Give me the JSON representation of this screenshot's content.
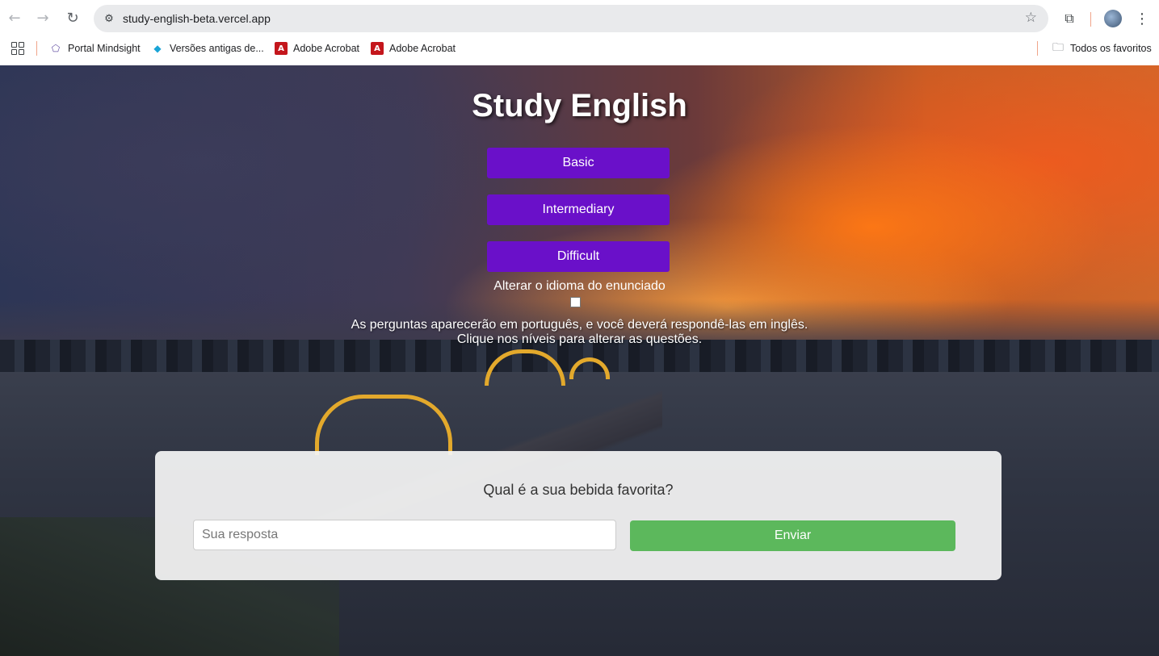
{
  "browser": {
    "url": "study-english-beta.vercel.app",
    "bookmarks": [
      {
        "label": "Portal Mindsight",
        "icon": "pentagon-icon"
      },
      {
        "label": "Versões antigas de...",
        "icon": "diamond-icon"
      },
      {
        "label": "Adobe Acrobat",
        "icon": "pdf-icon"
      },
      {
        "label": "Adobe Acrobat",
        "icon": "pdf-icon"
      }
    ],
    "all_bookmarks_label": "Todos os favoritos"
  },
  "page": {
    "title": "Study English",
    "levels": [
      "Basic",
      "Intermediary",
      "Difficult"
    ],
    "language_toggle_label": "Alterar o idioma do enunciado",
    "language_toggle_checked": false,
    "info_line1": "As perguntas aparecerão em português, e você deverá respondê-las em inglês.",
    "info_line2": "Clique nos níveis para alterar as questões.",
    "question": "Qual é a sua bebida favorita?",
    "answer_placeholder": "Sua resposta",
    "answer_value": "",
    "submit_label": "Enviar",
    "colors": {
      "level_button": "#6a10c9",
      "submit_button": "#5cb85c"
    }
  }
}
